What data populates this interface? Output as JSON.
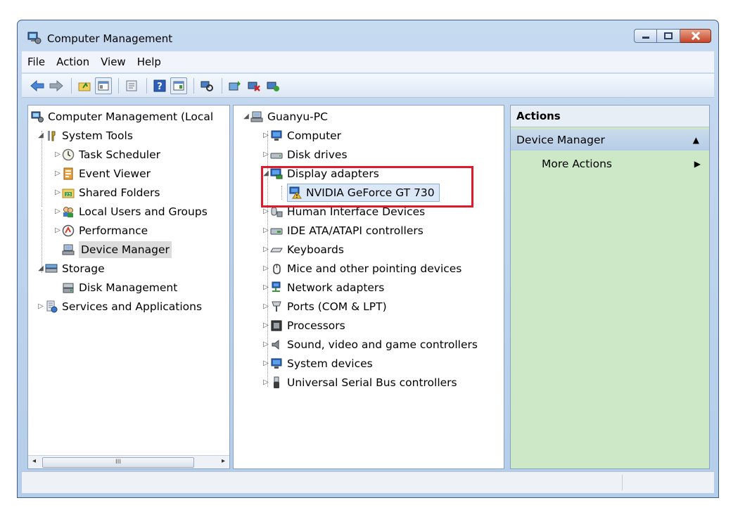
{
  "window": {
    "title": "Computer Management"
  },
  "menu": [
    "File",
    "Action",
    "View",
    "Help"
  ],
  "left_tree": [
    {
      "label": "Computer Management (Local",
      "level": 0,
      "expander": "",
      "icon": "computer-management-icon"
    },
    {
      "label": "System Tools",
      "level": 1,
      "expander": "expanded",
      "icon": "system-tools-icon"
    },
    {
      "label": "Task Scheduler",
      "level": 2,
      "expander": "collapsed",
      "icon": "clock-icon"
    },
    {
      "label": "Event Viewer",
      "level": 2,
      "expander": "collapsed",
      "icon": "event-viewer-icon"
    },
    {
      "label": "Shared Folders",
      "level": 2,
      "expander": "collapsed",
      "icon": "shared-folders-icon"
    },
    {
      "label": "Local Users and Groups",
      "level": 2,
      "expander": "collapsed",
      "icon": "users-icon"
    },
    {
      "label": "Performance",
      "level": 2,
      "expander": "collapsed",
      "icon": "performance-icon"
    },
    {
      "label": "Device Manager",
      "level": 2,
      "expander": "",
      "icon": "device-manager-icon",
      "selected": true
    },
    {
      "label": "Storage",
      "level": 1,
      "expander": "expanded",
      "icon": "storage-icon"
    },
    {
      "label": "Disk Management",
      "level": 2,
      "expander": "",
      "icon": "disk-management-icon"
    },
    {
      "label": "Services and Applications",
      "level": 1,
      "expander": "collapsed",
      "icon": "services-icon"
    }
  ],
  "device_tree": {
    "root": "Guanyu-PC",
    "categories": [
      "Computer",
      "Disk drives",
      "Display adapters",
      "Human Interface Devices",
      "IDE ATA/ATAPI controllers",
      "Keyboards",
      "Mice and other pointing devices",
      "Network adapters",
      "Ports (COM & LPT)",
      "Processors",
      "Sound, video and game controllers",
      "System devices",
      "Universal Serial Bus controllers"
    ],
    "expanded_device": "NVIDIA GeForce GT 730"
  },
  "actions": {
    "header": "Actions",
    "section": "Device Manager",
    "more": "More Actions"
  },
  "scrollbar": {
    "thumb_text": "III"
  },
  "colors": {
    "highlight": "#e01a2a",
    "actions_bg": "#cde8c6",
    "warning": "#f2c230"
  }
}
